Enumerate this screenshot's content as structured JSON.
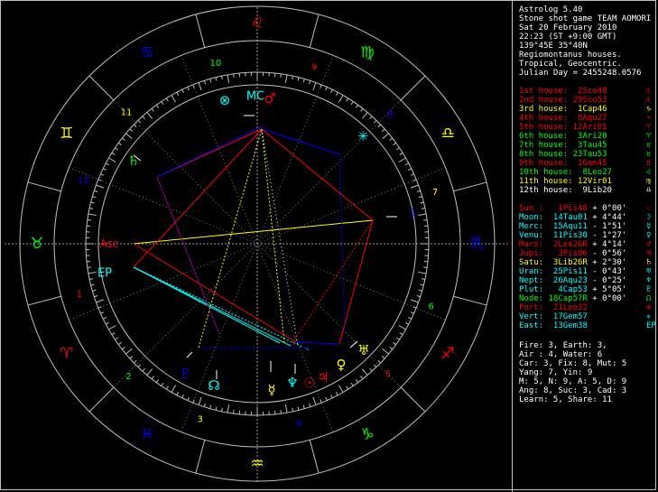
{
  "header": {
    "program": "Astrolog 5.40",
    "name": "Stone shot game TEAM AOMORI",
    "date": "Sat 20 February 2010",
    "time": "22:23 (ST +9:00 GMT)",
    "location": "139°45E 35°40N",
    "houses": "Regiomontanus houses.",
    "zodiac": "Tropical, Geocentric.",
    "julian": "Julian Day = 2455248.0576"
  },
  "houses": [
    {
      "label": "1st house:",
      "value": "2Sco48",
      "color": "#ff0000",
      "sign": "♏"
    },
    {
      "label": "2nd house:",
      "value": "29Sco53",
      "color": "#ff0000",
      "sign": "♏"
    },
    {
      "label": "3rd house:",
      "value": "1Cap46",
      "color": "#ffff00",
      "sign": "♑"
    },
    {
      "label": "4th house:",
      "value": "8Aqu27",
      "color": "#ff0000",
      "sign": "♒"
    },
    {
      "label": "5th house:",
      "value": "12Ari01",
      "color": "#ff0000",
      "sign": "♈"
    },
    {
      "label": "6th house:",
      "value": "3Ari20",
      "color": "#00ff00",
      "sign": "♈"
    },
    {
      "label": "7th house:",
      "value": "3Tau45",
      "color": "#00ff00",
      "sign": "♉"
    },
    {
      "label": "8th house:",
      "value": "23Tau53",
      "color": "#00ff00",
      "sign": "♉"
    },
    {
      "label": "9th house:",
      "value": "1Gem45",
      "color": "#ff0000",
      "sign": "♊"
    },
    {
      "label": "10th house:",
      "value": "8Leo27",
      "color": "#00ff00",
      "sign": "♌"
    },
    {
      "label": "11th house:",
      "value": "12Vir01",
      "color": "#ffff00",
      "sign": "♍"
    },
    {
      "label": "12th house:",
      "value": "9Lib20",
      "color": "#ffffff",
      "sign": "♎"
    }
  ],
  "planets": [
    {
      "name": "Sun :",
      "pos": "1Pis48",
      "speed": "+ 0°00'",
      "color": "#ff0000",
      "glyph": "☉"
    },
    {
      "name": "Moon:",
      "pos": "14Tau01",
      "speed": "+ 4°44'",
      "color": "#00ffff",
      "glyph": "☽"
    },
    {
      "name": "Merc:",
      "pos": "15Aqu11",
      "speed": "- 1°51'",
      "color": "#00ffff",
      "glyph": "☿"
    },
    {
      "name": "Venu:",
      "pos": "11Pis30",
      "speed": "- 1°27'",
      "color": "#00ffff",
      "glyph": "♀"
    },
    {
      "name": "Mars:",
      "pos": "2Leo26R",
      "speed": "+ 4°14'",
      "color": "#ff0000",
      "glyph": "♂"
    },
    {
      "name": "Jupi:",
      "pos": "3Pis06",
      "speed": "- 0°56'",
      "color": "#ff0000",
      "glyph": "♃"
    },
    {
      "name": "Satu:",
      "pos": "3Lib26R",
      "speed": "+ 2°30'",
      "color": "#ffff00",
      "glyph": "♄"
    },
    {
      "name": "Uran:",
      "pos": "25Pis11",
      "speed": "- 0°43'",
      "color": "#00ffff",
      "glyph": "♅"
    },
    {
      "name": "Nept:",
      "pos": "26Aqu23",
      "speed": "- 0°25'",
      "color": "#00ffff",
      "glyph": "♆"
    },
    {
      "name": "Plut:",
      "pos": "4Cap53",
      "speed": "+ 5°05'",
      "color": "#00ffff",
      "glyph": "♇"
    },
    {
      "name": "Node:",
      "pos": "18Cap57R",
      "speed": "+ 0°00'",
      "color": "#00ff00",
      "glyph": "☊"
    },
    {
      "name": "Fort:",
      "pos": "21Leo32",
      "speed": "",
      "color": "#ff0000",
      "glyph": "⊗"
    },
    {
      "name": "Vert:",
      "pos": "17Gem57",
      "speed": "",
      "color": "#00ffff",
      "glyph": "✳"
    },
    {
      "name": "East:",
      "pos": "13Gem38",
      "speed": "",
      "color": "#00ffff",
      "glyph": "EP"
    }
  ],
  "stats": [
    "Fire: 3, Earth: 3,",
    "Air : 4, Water: 6",
    "Car: 3, Fix: 8, Mut: 5",
    "Yang: 7, Yin: 9",
    "M: 5, N: 9, A: 5, D: 9",
    "Ang: 8, Suc: 3, Cad: 3",
    "Learn: 5, Share: 11"
  ],
  "chart_data": {
    "type": "astrological-wheel",
    "ascendant": "2Sco48",
    "midheaven": "8Leo27",
    "zodiac_signs": [
      {
        "glyph": "♌",
        "color": "#ff0000"
      },
      {
        "glyph": "♋",
        "color": "#0000ff"
      },
      {
        "glyph": "♊",
        "color": "#ffff00"
      },
      {
        "glyph": "♉",
        "color": "#00ff00"
      },
      {
        "glyph": "♈",
        "color": "#ff0000"
      },
      {
        "glyph": "♓",
        "color": "#0000ff"
      },
      {
        "glyph": "♒",
        "color": "#ffff00"
      },
      {
        "glyph": "♑",
        "color": "#00ff00"
      },
      {
        "glyph": "♐",
        "color": "#ff0000"
      },
      {
        "glyph": "♏",
        "color": "#0000ff"
      },
      {
        "glyph": "♎",
        "color": "#ffff00"
      },
      {
        "glyph": "♍",
        "color": "#00ff00"
      }
    ],
    "house_numbers": [
      {
        "label": "1",
        "color": "#ff0000"
      },
      {
        "label": "2",
        "color": "#00ff00"
      },
      {
        "label": "3",
        "color": "#ffff00"
      },
      {
        "label": "4",
        "color": "#0000ff"
      },
      {
        "label": "5",
        "color": "#ff0000"
      },
      {
        "label": "6",
        "color": "#00ff00"
      },
      {
        "label": "7",
        "color": "#ffff00"
      },
      {
        "label": "8",
        "color": "#0000ff"
      },
      {
        "label": "9",
        "color": "#ff0000"
      },
      {
        "label": "10",
        "color": "#00ff00"
      },
      {
        "label": "11",
        "color": "#ffff00"
      },
      {
        "label": "12",
        "color": "#0000ff"
      }
    ],
    "chart_points": [
      {
        "label": "Asc",
        "color": "#ff0000"
      },
      {
        "label": "MC",
        "color": "#00ffff"
      },
      {
        "label": "EP",
        "color": "#00ffff"
      }
    ]
  }
}
